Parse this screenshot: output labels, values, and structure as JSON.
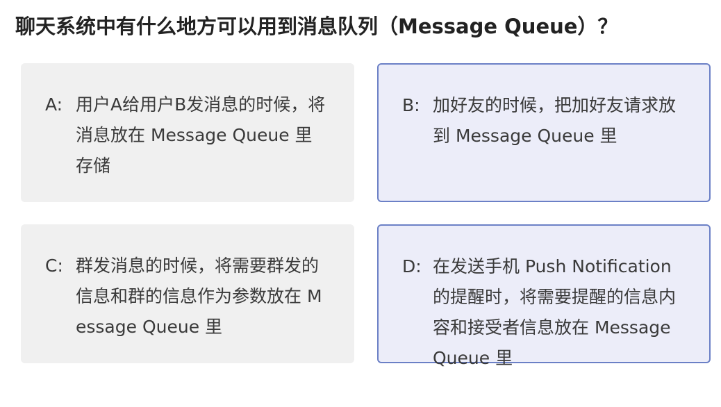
{
  "question": {
    "title": "聊天系统中有什么地方可以用到消息队列（Message Queue）？"
  },
  "options": [
    {
      "letter": "A:",
      "text": "用户A给用户B发消息的时候，将消息放在 Message Queue 里存储",
      "selected": false
    },
    {
      "letter": "B:",
      "text": "加好友的时候，把加好友请求放到 Message Queue 里",
      "selected": true
    },
    {
      "letter": "C:",
      "text": "群发消息的时候，将需要群发的信息和群的信息作为参数放在 Message Queue 里",
      "selected": false
    },
    {
      "letter": "D:",
      "text": "在发送手机 Push Notification 的提醒时，将需要提醒的信息内容和接受者信息放在 Message Queue 里",
      "selected": true
    }
  ],
  "colors": {
    "unselected_bg": "#f0f0f0",
    "selected_bg": "#ecedf9",
    "selected_border": "#6b80c6"
  }
}
